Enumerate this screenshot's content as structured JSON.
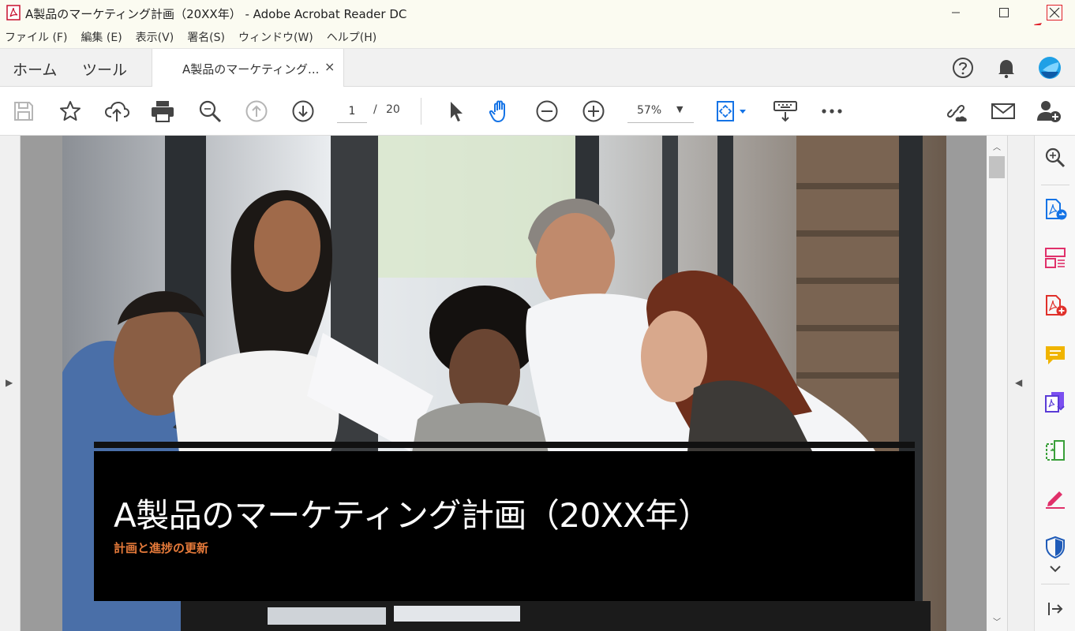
{
  "window": {
    "title": "A製品のマーケティング計画（20XX年） - Adobe Acrobat Reader DC"
  },
  "menu": [
    "ファイル (F)",
    "編集 (E)",
    "表示(V)",
    "署名(S)",
    "ウィンドウ(W)",
    "ヘルプ(H)"
  ],
  "tabs": {
    "home": "ホーム",
    "tools": "ツール",
    "document": "A製品のマーケティング...",
    "close": "×"
  },
  "toolbar": {
    "page_current": "1",
    "page_sep": "/",
    "page_total": "20",
    "zoom": "57%",
    "zoom_caret": "▼"
  },
  "document": {
    "title": "A製品のマーケティング計画（20XX年）",
    "subtitle": "計画と進捗の更新"
  },
  "colors": {
    "accent_blue": "#1473e6",
    "close_highlight": "#e0202a",
    "subtitle_orange": "#e67a3a"
  }
}
